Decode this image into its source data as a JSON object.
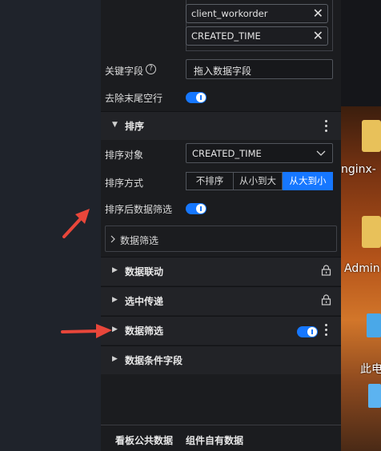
{
  "filter_tags": [
    "client_workorder",
    "CREATED_TIME"
  ],
  "key_field": {
    "label": "关键字段",
    "placeholder": "拖入数据字段"
  },
  "trim_empty_rows": {
    "label": "去除末尾空行",
    "enabled": true
  },
  "sort_section": {
    "title": "排序",
    "sort_target_label": "排序对象",
    "sort_target_value": "CREATED_TIME",
    "sort_method_label": "排序方式",
    "sort_options": [
      "不排序",
      "从小到大",
      "从大到小"
    ],
    "sort_selected": "从大到小",
    "filter_after_sort_label": "排序后数据筛选",
    "filter_after_sort_enabled": true,
    "data_filter_row_label": "数据筛选"
  },
  "sections": [
    {
      "title": "数据联动",
      "locked": true
    },
    {
      "title": "选中传递",
      "locked": true
    },
    {
      "title": "数据筛选",
      "toggle_enabled": true
    },
    {
      "title": "数据条件字段"
    }
  ],
  "bottom_tabs": [
    "看板公共数据",
    "组件自有数据"
  ],
  "desktop": {
    "labels": [
      "nginx-",
      "Admin",
      "此电"
    ]
  },
  "colors": {
    "accent": "#1677ff",
    "annotation_arrow": "#e8463a"
  }
}
